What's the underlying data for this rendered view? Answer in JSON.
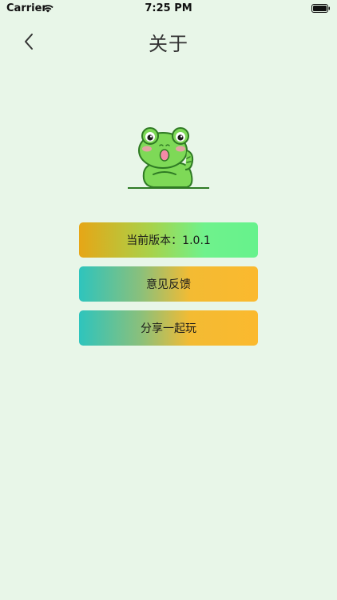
{
  "status_bar": {
    "carrier": "Carrier",
    "time": "7:25 PM",
    "wifi_icon": "wifi-icon",
    "battery_icon": "battery-icon"
  },
  "nav": {
    "back_icon": "chevron-left-icon",
    "title": "关于"
  },
  "mascot": {
    "icon": "frog-mascot-icon"
  },
  "buttons": {
    "version": "当前版本：1.0.1",
    "feedback": "意见反馈",
    "share": "分享一起玩"
  },
  "colors": {
    "background": "#e8f6e8",
    "frog_green": "#7ed957",
    "frog_outline": "#2f7a24",
    "gradient_orange": "#e6a616",
    "gradient_green": "#66f28c",
    "gradient_teal": "#2ec4bd",
    "gradient_yellow": "#fbb92e"
  }
}
